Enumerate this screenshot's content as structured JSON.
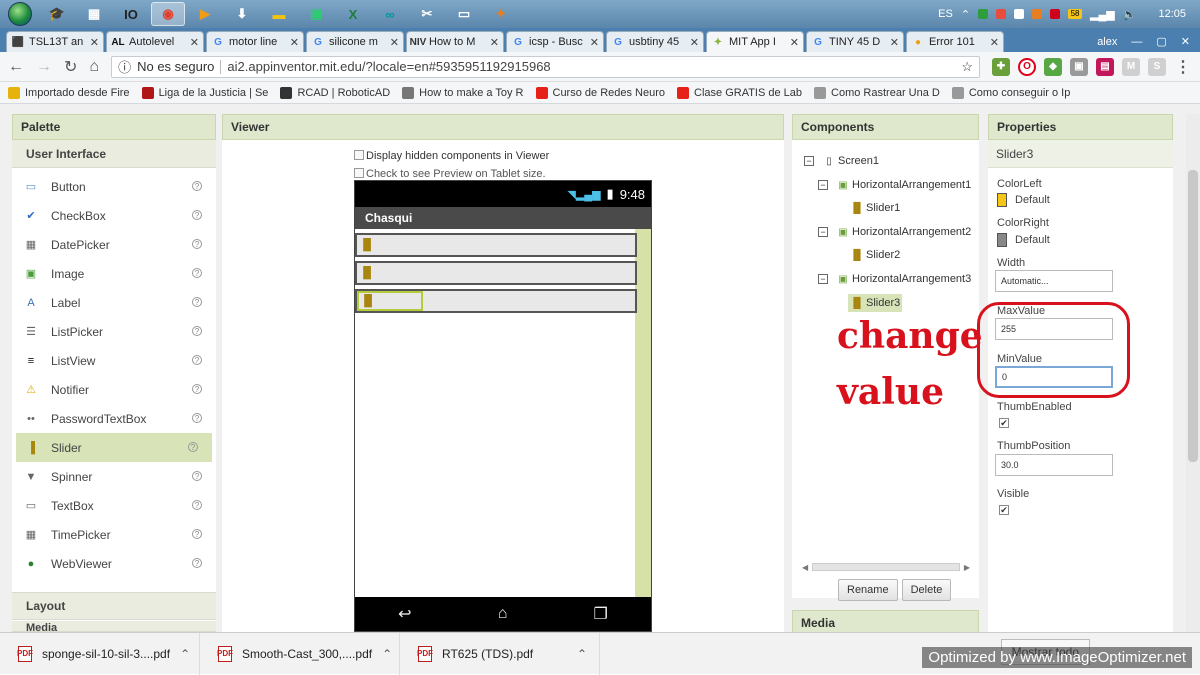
{
  "taskbar": {
    "lang": "ES",
    "clock": "12:05",
    "badge": "58"
  },
  "tabs": [
    {
      "label": "TSL13T an",
      "fav": "⬛",
      "color": "#c0392b"
    },
    {
      "label": "Autolevel",
      "fav": "AL",
      "color": "#111111"
    },
    {
      "label": "motor line",
      "fav": "G",
      "color": "#4285f4"
    },
    {
      "label": "silicone m",
      "fav": "G",
      "color": "#4285f4"
    },
    {
      "label": "How to M",
      "fav": "NIV",
      "color": "#333333"
    },
    {
      "label": "icsp - Busc",
      "fav": "G",
      "color": "#4285f4"
    },
    {
      "label": "usbtiny 45",
      "fav": "G",
      "color": "#4285f4"
    },
    {
      "label": "MIT App I",
      "fav": "✦",
      "color": "#8bb33a"
    },
    {
      "label": "TINY 45 D",
      "fav": "G",
      "color": "#4285f4"
    },
    {
      "label": "Error 101",
      "fav": "●",
      "color": "#e8a317"
    }
  ],
  "user": "alex",
  "address": {
    "security": "No es seguro",
    "url": "ai2.appinventor.mit.edu/?locale=en#5935951192915968"
  },
  "bookmarks": [
    {
      "label": "Importado desde Fire",
      "color": "#e8b20c"
    },
    {
      "label": "Liga de la Justicia | Se",
      "color": "#b01818"
    },
    {
      "label": "RCAD | RoboticAD",
      "color": "#333333"
    },
    {
      "label": "How to make a Toy R",
      "color": "#777777"
    },
    {
      "label": "Curso de Redes Neuro",
      "color": "#e62117"
    },
    {
      "label": "Clase GRATIS de Lab",
      "color": "#e62117"
    },
    {
      "label": "Como Rastrear Una D",
      "color": "#999999"
    },
    {
      "label": "Como conseguir o Ip",
      "color": "#999999"
    }
  ],
  "palette": {
    "title": "Palette",
    "category": "User Interface",
    "items": [
      {
        "label": "Button",
        "icon": "▭",
        "color": "#5a8ed0"
      },
      {
        "label": "CheckBox",
        "icon": "✔",
        "color": "#2b6cc4"
      },
      {
        "label": "DatePicker",
        "icon": "▦",
        "color": "#666666"
      },
      {
        "label": "Image",
        "icon": "▣",
        "color": "#4a9c3c"
      },
      {
        "label": "Label",
        "icon": "A",
        "color": "#3b6fb5"
      },
      {
        "label": "ListPicker",
        "icon": "☰",
        "color": "#666666"
      },
      {
        "label": "ListView",
        "icon": "≡",
        "color": "#111111"
      },
      {
        "label": "Notifier",
        "icon": "⚠",
        "color": "#e0a800"
      },
      {
        "label": "PasswordTextBox",
        "icon": "••",
        "color": "#666666"
      },
      {
        "label": "Slider",
        "icon": "▐",
        "color": "#a8850c"
      },
      {
        "label": "Spinner",
        "icon": "▼",
        "color": "#666666"
      },
      {
        "label": "TextBox",
        "icon": "▭",
        "color": "#666666"
      },
      {
        "label": "TimePicker",
        "icon": "▦",
        "color": "#666666"
      },
      {
        "label": "WebViewer",
        "icon": "●",
        "color": "#2e7d32"
      }
    ],
    "layout": "Layout",
    "media_partial": "Media"
  },
  "viewer": {
    "title": "Viewer",
    "opt_hidden": "Display hidden components in Viewer",
    "opt_tablet": "Check to see Preview on Tablet size.",
    "phone_time": "9:48",
    "screen_title": "Chasqui"
  },
  "components": {
    "title": "Components",
    "tree": {
      "screen": "Screen1",
      "ha1": "HorizontalArrangement1",
      "s1": "Slider1",
      "ha2": "HorizontalArrangement2",
      "s2": "Slider2",
      "ha3": "HorizontalArrangement3",
      "s3": "Slider3"
    },
    "rename": "Rename",
    "delete": "Delete",
    "media": "Media"
  },
  "properties": {
    "title": "Properties",
    "component": "Slider3",
    "color_left_label": "ColorLeft",
    "color_left_value": "Default",
    "color_left_swatch": "#f5c518",
    "color_right_label": "ColorRight",
    "color_right_value": "Default",
    "color_right_swatch": "#888888",
    "width_label": "Width",
    "width_value": "Automatic...",
    "max_label": "MaxValue",
    "max_value": "255",
    "min_label": "MinValue",
    "min_value": "0",
    "thumb_enabled_label": "ThumbEnabled",
    "thumb_position_label": "ThumbPosition",
    "thumb_position_value": "30.0",
    "visible_label": "Visible"
  },
  "annotation": {
    "line1": "change",
    "line2": "value",
    "color": "#d8121d"
  },
  "downloads": [
    {
      "label": "sponge-sil-10-sil-3....pdf"
    },
    {
      "label": "Smooth-Cast_300,....pdf"
    },
    {
      "label": "RT625 (TDS).pdf"
    }
  ],
  "show_all": "Mostrar todo",
  "watermark": "Optimized by www.ImageOptimizer.net"
}
